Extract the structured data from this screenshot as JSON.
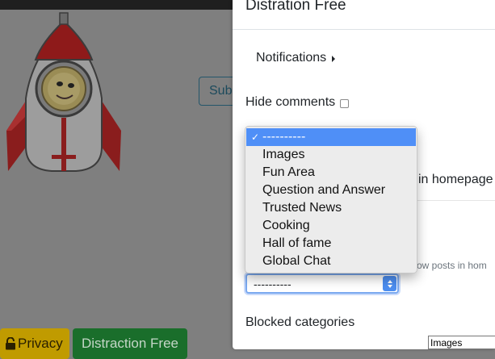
{
  "background": {
    "subscribe_partial": "Sub",
    "privacy_label": "Privacy",
    "distraction_label": "Distraction Free"
  },
  "panel": {
    "title": "Distration Free",
    "notifications_label": "Notifications",
    "hide_comments_label": "Hide comments",
    "hide_comments_checked": false,
    "in_homepage_text": "in homepage",
    "show_posts_text": "ow posts in hom",
    "select_value": "----------",
    "blocked_label": "Blocked categories",
    "images_field_value": "Images"
  },
  "dropdown": {
    "options": [
      {
        "label": "----------",
        "selected": true
      },
      {
        "label": "Images",
        "selected": false
      },
      {
        "label": "Fun Area",
        "selected": false
      },
      {
        "label": "Question and Answer",
        "selected": false
      },
      {
        "label": "Trusted News",
        "selected": false
      },
      {
        "label": "Cooking",
        "selected": false
      },
      {
        "label": "Hall of fame",
        "selected": false
      },
      {
        "label": "Global Chat",
        "selected": false
      }
    ]
  },
  "colors": {
    "privacy_bg": "#c09b00",
    "distraction_bg": "#1a6e2b",
    "selection_blue": "#4f8ff7"
  }
}
